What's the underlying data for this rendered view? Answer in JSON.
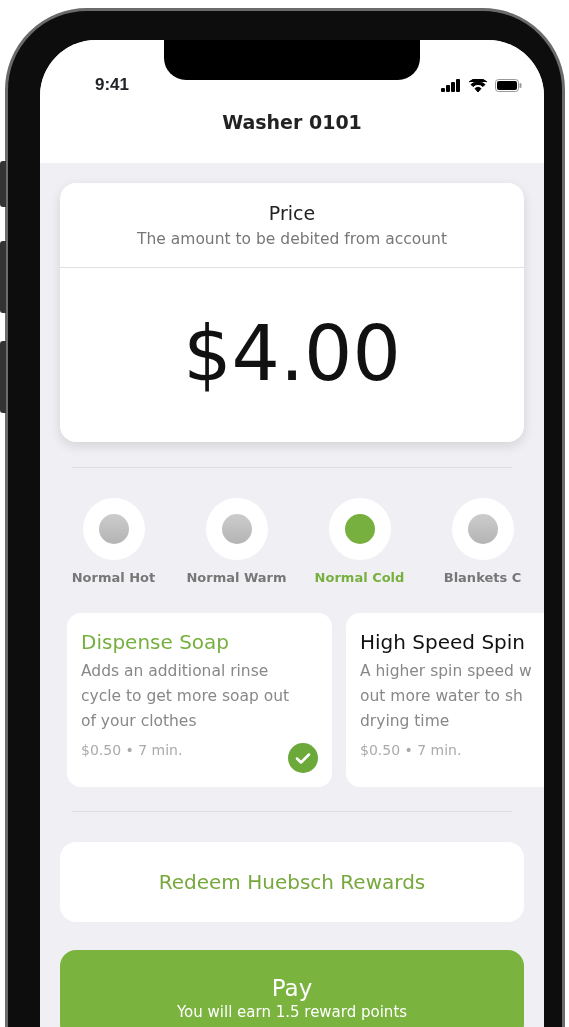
{
  "status_bar": {
    "time": "9:41"
  },
  "header": {
    "title": "Washer 0101"
  },
  "price": {
    "title": "Price",
    "subtitle": "The amount to be debited from account",
    "amount": "$4.00"
  },
  "cycles": [
    {
      "label": "Normal Hot",
      "selected": false
    },
    {
      "label": "Normal Warm",
      "selected": false
    },
    {
      "label": "Normal Cold",
      "selected": true
    },
    {
      "label": "Blankets C",
      "selected": false
    }
  ],
  "options": [
    {
      "title": "Dispense Soap",
      "description_lines": [
        "Adds an additional rinse",
        "cycle to get more soap out",
        "of your clothes"
      ],
      "meta": "$0.50 • 7 min.",
      "selected": true
    },
    {
      "title": "High Speed Spin",
      "description_lines": [
        "A higher spin speed w",
        "out more water to sh",
        "drying time"
      ],
      "meta": "$0.50 • 7 min.",
      "selected": false
    }
  ],
  "rewards": {
    "label": "Redeem Huebsch Rewards"
  },
  "pay": {
    "label": "Pay",
    "note": "You will earn 1.5 reward points"
  }
}
